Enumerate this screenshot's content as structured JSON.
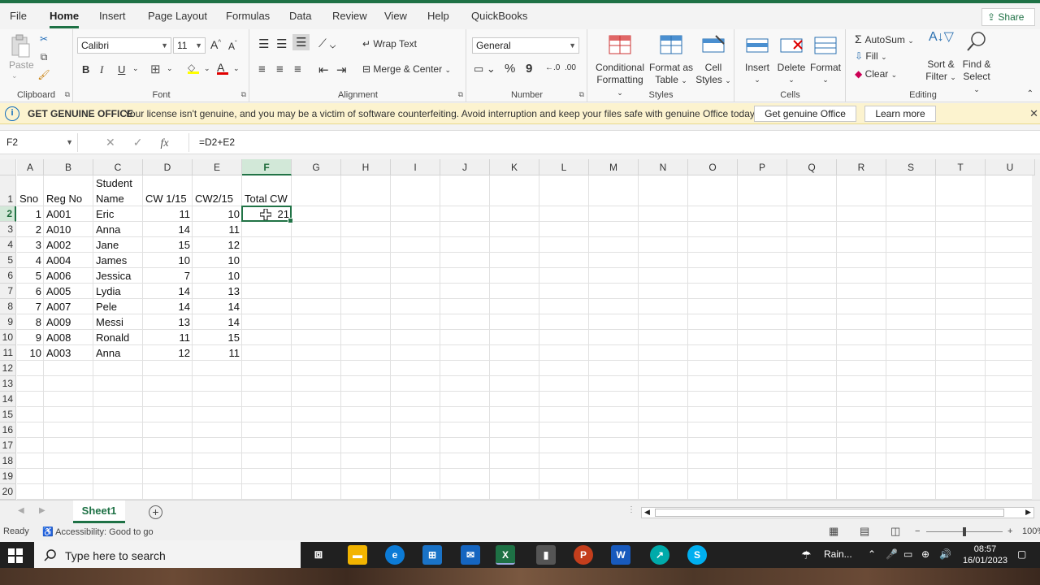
{
  "tabs": [
    "File",
    "Home",
    "Insert",
    "Page Layout",
    "Formulas",
    "Data",
    "Review",
    "View",
    "Help",
    "QuickBooks"
  ],
  "active_tab": "Home",
  "share_label": "Share",
  "ribbon": {
    "clipboard": {
      "label": "Clipboard",
      "paste": "Paste"
    },
    "font": {
      "label": "Font",
      "name": "Calibri",
      "size": "11",
      "bold": "B",
      "italic": "I",
      "underline": "U",
      "grow": "A",
      "shrink": "A",
      "color_letter": "A"
    },
    "alignment": {
      "label": "Alignment",
      "wrap": "Wrap Text",
      "merge": "Merge & Center"
    },
    "number": {
      "label": "Number",
      "format": "General",
      "percent": "%",
      "comma": "9"
    },
    "styles": {
      "label": "Styles",
      "conditional": [
        "Conditional",
        "Formatting"
      ],
      "format_table": [
        "Format as",
        "Table"
      ],
      "cell_styles": [
        "Cell",
        "Styles"
      ]
    },
    "cells": {
      "label": "Cells",
      "insert": "Insert",
      "delete": "Delete",
      "format": "Format"
    },
    "editing": {
      "label": "Editing",
      "autosum": "AutoSum",
      "fill": "Fill",
      "clear": "Clear",
      "sort": [
        "Sort &",
        "Filter"
      ],
      "find": [
        "Find &",
        "Select"
      ]
    }
  },
  "license": {
    "title": "GET GENUINE OFFICE",
    "message": "Your license isn't genuine, and you may be a victim of software counterfeiting. Avoid interruption and keep your files safe with genuine Office today.",
    "btn_genuine": "Get genuine Office",
    "btn_learn": "Learn more"
  },
  "formula_bar": {
    "name_box": "F2",
    "formula": "=D2+E2",
    "fx": "fx"
  },
  "columns": [
    "A",
    "B",
    "C",
    "D",
    "E",
    "F",
    "G",
    "H",
    "I",
    "J",
    "K",
    "L",
    "M",
    "N",
    "O",
    "P",
    "Q",
    "R",
    "S",
    "T",
    "U"
  ],
  "row_numbers": [
    "1",
    "2",
    "3",
    "4",
    "5",
    "6",
    "7",
    "8",
    "9",
    "10",
    "11",
    "12",
    "13",
    "14",
    "15",
    "16",
    "17",
    "18",
    "19",
    "20"
  ],
  "headers": {
    "sno": "Sno",
    "reg": "Reg No",
    "name_line1": "Student",
    "name_line2": "Name",
    "cw1": "CW 1/15",
    "cw2": "CW2/15",
    "total": "Total CW"
  },
  "rows": [
    {
      "sno": "1",
      "reg": "A001",
      "name": "Eric",
      "cw1": "11",
      "cw2": "10",
      "total": "21"
    },
    {
      "sno": "2",
      "reg": "A010",
      "name": "Anna",
      "cw1": "14",
      "cw2": "11",
      "total": ""
    },
    {
      "sno": "3",
      "reg": "A002",
      "name": "Jane",
      "cw1": "15",
      "cw2": "12",
      "total": ""
    },
    {
      "sno": "4",
      "reg": "A004",
      "name": "James",
      "cw1": "10",
      "cw2": "10",
      "total": ""
    },
    {
      "sno": "5",
      "reg": "A006",
      "name": "Jessica",
      "cw1": "7",
      "cw2": "10",
      "total": ""
    },
    {
      "sno": "6",
      "reg": "A005",
      "name": "Lydia",
      "cw1": "14",
      "cw2": "13",
      "total": ""
    },
    {
      "sno": "7",
      "reg": "A007",
      "name": "Pele",
      "cw1": "14",
      "cw2": "14",
      "total": ""
    },
    {
      "sno": "8",
      "reg": "A009",
      "name": "Messi",
      "cw1": "13",
      "cw2": "14",
      "total": ""
    },
    {
      "sno": "9",
      "reg": "A008",
      "name": "Ronald",
      "cw1": "11",
      "cw2": "15",
      "total": ""
    },
    {
      "sno": "10",
      "reg": "A003",
      "name": "Anna",
      "cw1": "12",
      "cw2": "11",
      "total": ""
    }
  ],
  "sheet_tab": "Sheet1",
  "status": {
    "ready": "Ready",
    "accessibility": "Accessibility: Good to go",
    "zoom": "100%"
  },
  "taskbar": {
    "search_placeholder": "Type here to search",
    "weather": "Rain...",
    "time": "08:57",
    "date": "16/01/2023"
  },
  "colors": {
    "excel_green": "#217346",
    "license_bg": "#fcf3cf"
  }
}
